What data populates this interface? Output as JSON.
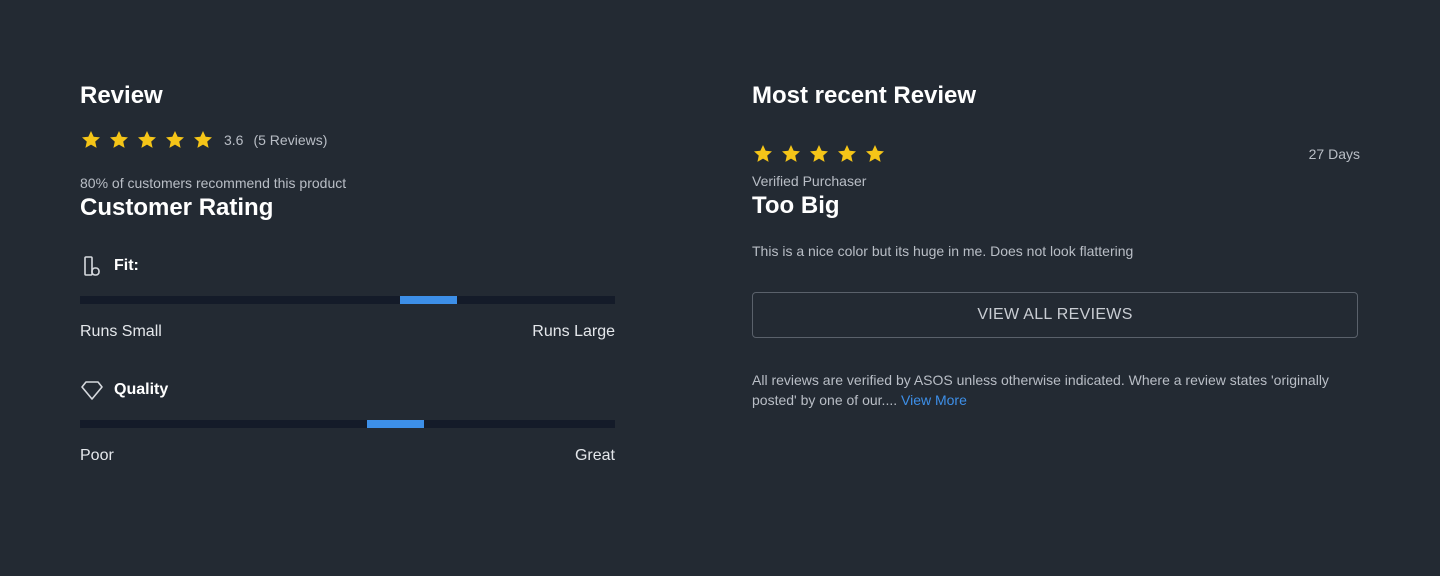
{
  "colors": {
    "background": "#232a33",
    "star": "#f5c518",
    "accent": "#3d8fe8",
    "bar_track": "#141b29"
  },
  "summary": {
    "title": "Review",
    "star_icon": "star-icon",
    "rating": "3.6",
    "review_count": "(5 Reviews)",
    "recommend_text": "80% of customers recommend this product"
  },
  "customer_rating": {
    "title": "Customer Rating",
    "fit": {
      "icon": "fit-icon",
      "label": "Fit:",
      "low_label": "Runs Small",
      "high_label": "Runs Large",
      "position_fraction": 0.67
    },
    "quality": {
      "icon": "diamond-icon",
      "label": "Quality",
      "low_label": "Poor",
      "high_label": "Great",
      "position_fraction": 0.6
    }
  },
  "recent_review": {
    "section_title": "Most recent Review",
    "stars": 5,
    "age": "27 Days",
    "verified_label": "Verified Purchaser",
    "title": "Too Big",
    "body": "This is a nice color but its huge in me. Does not look flattering",
    "view_all_label": "VIEW ALL REVIEWS",
    "disclaimer_text": "All reviews are verified by ASOS unless otherwise indicated. Where a review states 'originally posted' by one of our.... ",
    "view_more_label": "View More"
  }
}
